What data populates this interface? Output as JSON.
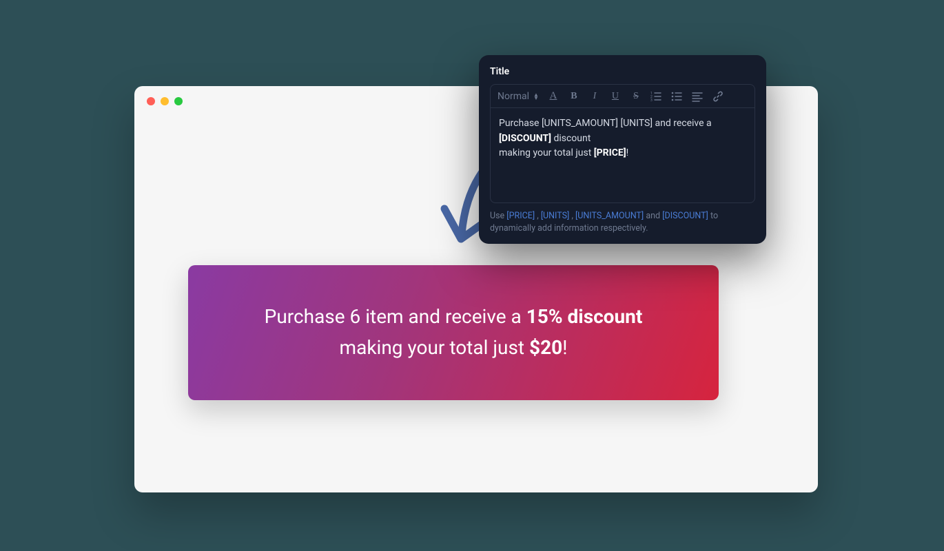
{
  "editor": {
    "title": "Title",
    "format_select": "Normal",
    "content": {
      "line1_pre": "Purchase ",
      "units_amount_token": "[UNITS_AMOUNT]",
      "line1_mid": " ",
      "units_token": "[UNITS]",
      "line1_post": " and receive a",
      "discount_token": "[DISCOUNT]",
      "line2_post": " discount",
      "line3_pre": "making your total just ",
      "price_token": "[PRICE]",
      "line3_post": "!"
    },
    "helper": {
      "pre": "Use ",
      "t1": "[PRICE]",
      "sep1": " , ",
      "t2": "[UNITS]",
      "sep2": " , ",
      "t3": "[UNITS_AMOUNT]",
      "sep3": " and ",
      "t4": "[DISCOUNT]",
      "post": " to dynamically add information respectively."
    }
  },
  "banner": {
    "line1_pre": "Purchase 6 item and receive a ",
    "line1_bold": "15% discount",
    "line2_pre": "making your total just ",
    "line2_bold": "$20",
    "line2_post": "!"
  }
}
